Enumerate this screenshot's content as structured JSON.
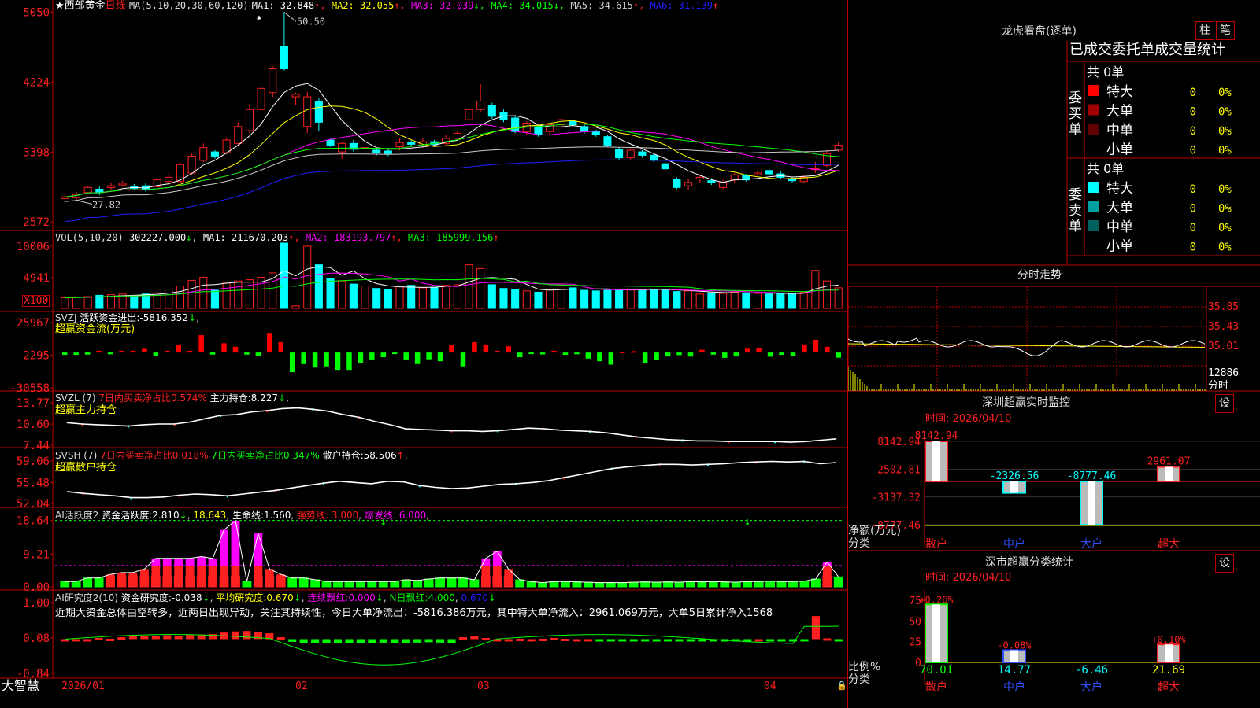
{
  "colors": {
    "up": "#ff2020",
    "down": "#00ffff",
    "frame": "#c00000",
    "buy": "#ff0000",
    "sell": "#00ffff"
  },
  "main": {
    "star": "★",
    "stock": "西部黄金",
    "period": "日线",
    "ma_prefix": "MA(5,10,20,30,60,120)",
    "ma": [
      {
        "label": "MA1: 32.848",
        "arrow": "↑",
        "color": "#ffffff"
      },
      {
        "label": "MA2: 32.055",
        "arrow": "↑",
        "color": "#ffff00"
      },
      {
        "label": "MA3: 32.039",
        "arrow": "↓",
        "color": "#ff00ff"
      },
      {
        "label": "MA4: 34.015",
        "arrow": "↓",
        "color": "#00ff00"
      },
      {
        "label": "MA5: 34.615",
        "arrow": "↑",
        "color": "#cccccc"
      },
      {
        "label": "MA6: 31.139",
        "arrow": "↑",
        "color": "#2020ff"
      }
    ],
    "yticks": [
      "5050",
      "4224",
      "3398",
      "2572"
    ],
    "high_label": "50.50",
    "low_label": "27.82"
  },
  "chart_data": [
    {
      "type": "candlestick",
      "name": "main",
      "ylim": [
        2500,
        5100
      ],
      "candles": [
        [
          2850,
          2870,
          2800,
          2920
        ],
        [
          2860,
          2900,
          2830,
          2930
        ],
        [
          2920,
          2980,
          2900,
          3000
        ],
        [
          2960,
          2920,
          2890,
          2990
        ],
        [
          2980,
          3000,
          2950,
          3040
        ],
        [
          3010,
          3030,
          2990,
          3060
        ],
        [
          2990,
          2970,
          2950,
          3020
        ],
        [
          3000,
          2950,
          2930,
          3030
        ],
        [
          2990,
          3070,
          2970,
          3090
        ],
        [
          3050,
          3100,
          3020,
          3150
        ],
        [
          3050,
          3250,
          3030,
          3280
        ],
        [
          3150,
          3350,
          3130,
          3380
        ],
        [
          3300,
          3450,
          3280,
          3500
        ],
        [
          3400,
          3350,
          3320,
          3420
        ],
        [
          3390,
          3540,
          3370,
          3570
        ],
        [
          3500,
          3700,
          3480,
          3750
        ],
        [
          3650,
          3900,
          3620,
          3960
        ],
        [
          3900,
          4150,
          3880,
          4200
        ],
        [
          4100,
          4380,
          4050,
          4410
        ],
        [
          4650,
          4380,
          4360,
          5050
        ],
        [
          4050,
          4080,
          3950,
          4100
        ],
        [
          3700,
          4050,
          3620,
          4110
        ],
        [
          4000,
          3750,
          3650,
          4030
        ],
        [
          3540,
          3480,
          3460,
          3560
        ],
        [
          3400,
          3500,
          3320,
          3510
        ],
        [
          3500,
          3430,
          3400,
          3540
        ],
        [
          3440,
          3450,
          3380,
          3500
        ],
        [
          3420,
          3390,
          3360,
          3450
        ],
        [
          3410,
          3380,
          3350,
          3440
        ],
        [
          3460,
          3510,
          3420,
          3560
        ],
        [
          3510,
          3490,
          3470,
          3540
        ],
        [
          3470,
          3520,
          3450,
          3560
        ],
        [
          3520,
          3490,
          3470,
          3540
        ],
        [
          3500,
          3560,
          3480,
          3600
        ],
        [
          3560,
          3620,
          3530,
          3650
        ],
        [
          3780,
          3900,
          3760,
          3920
        ],
        [
          3900,
          4000,
          3870,
          4200
        ],
        [
          3950,
          3820,
          3790,
          3980
        ],
        [
          3860,
          3780,
          3750,
          3900
        ],
        [
          3800,
          3640,
          3620,
          3820
        ],
        [
          3640,
          3740,
          3600,
          3760
        ],
        [
          3700,
          3600,
          3580,
          3720
        ],
        [
          3640,
          3720,
          3600,
          3740
        ],
        [
          3720,
          3780,
          3700,
          3800
        ],
        [
          3760,
          3720,
          3690,
          3790
        ],
        [
          3700,
          3640,
          3620,
          3720
        ],
        [
          3640,
          3600,
          3580,
          3660
        ],
        [
          3580,
          3480,
          3460,
          3600
        ],
        [
          3430,
          3330,
          3300,
          3450
        ],
        [
          3330,
          3420,
          3300,
          3440
        ],
        [
          3400,
          3360,
          3330,
          3420
        ],
        [
          3360,
          3300,
          3280,
          3380
        ],
        [
          3260,
          3200,
          3180,
          3280
        ],
        [
          3080,
          2980,
          2960,
          3100
        ],
        [
          3000,
          3040,
          2950,
          3080
        ],
        [
          3080,
          3100,
          3040,
          3120
        ],
        [
          3060,
          3040,
          3010,
          3090
        ],
        [
          2980,
          3040,
          2960,
          3070
        ],
        [
          3070,
          3130,
          3040,
          3150
        ],
        [
          3120,
          3070,
          3050,
          3140
        ],
        [
          3130,
          3150,
          3100,
          3180
        ],
        [
          3180,
          3140,
          3120,
          3200
        ],
        [
          3140,
          3100,
          3080,
          3170
        ],
        [
          3080,
          3060,
          3040,
          3100
        ],
        [
          3050,
          3100,
          3040,
          3130
        ],
        [
          3200,
          3200,
          3150,
          3280
        ],
        [
          3240,
          3380,
          3220,
          3420
        ],
        [
          3420,
          3480,
          3400,
          3520
        ]
      ]
    },
    {
      "type": "bar",
      "name": "volume",
      "title": "VOL(5,10,20)",
      "value_label": "302227.000",
      "value_arrow": "↓",
      "ma": [
        {
          "label": "MA1: 211670.203",
          "arrow": "↑",
          "color": "#ffffff"
        },
        {
          "label": "MA2: 183193.797",
          "arrow": "↑",
          "color": "#ff00ff"
        },
        {
          "label": "MA3: 185999.156",
          "arrow": "↑",
          "color": "#00ff00"
        }
      ],
      "yticks": [
        "10006",
        "4941"
      ],
      "unit_label": "X100",
      "ylim": [
        0,
        11000
      ],
      "values": [
        1700,
        1800,
        1900,
        2100,
        2200,
        2300,
        2000,
        2300,
        2500,
        3100,
        3600,
        4500,
        5000,
        2900,
        4200,
        4400,
        4600,
        5000,
        5700,
        10500,
        400,
        10000,
        7000,
        4800,
        4400,
        3900,
        3600,
        3200,
        3000,
        3600,
        3700,
        3300,
        3400,
        3700,
        3800,
        7000,
        6400,
        3800,
        3200,
        3000,
        2800,
        2600,
        3000,
        3700,
        3300,
        2900,
        2800,
        2900,
        3100,
        3100,
        3000,
        3100,
        2900,
        2700,
        2800,
        2300,
        2500,
        2400,
        2600,
        2500,
        2400,
        2300,
        2400,
        2300,
        2600,
        6100,
        4400,
        3300
      ]
    },
    {
      "type": "bar",
      "name": "svzj",
      "title": "SVZJ",
      "label": "活跃资金进出:",
      "value": "-5816.352",
      "value_arrow": "↓",
      "subtitle": "超赢资金流(万元)",
      "yticks": [
        "25967",
        "-2295",
        "-30558"
      ],
      "ylim": [
        -30558,
        25967
      ],
      "values": [
        -2000,
        -2000,
        -1800,
        1500,
        -1500,
        1500,
        1500,
        3200,
        -3200,
        1500,
        7000,
        1500,
        15000,
        -1800,
        8000,
        5000,
        -1800,
        -3200,
        17000,
        9000,
        -17000,
        -10000,
        -13000,
        -12000,
        -15000,
        -15000,
        -9000,
        -6000,
        -4000,
        -1200,
        -6000,
        -10000,
        -5800,
        -7500,
        6500,
        -12000,
        9000,
        7000,
        1500,
        5400,
        -4000,
        -1200,
        -1600,
        1500,
        -2000,
        -1500,
        -5200,
        -7500,
        -10500,
        800,
        1200,
        -9000,
        -6500,
        -3400,
        -2200,
        -3500,
        2400,
        -1800,
        -4600,
        -3400,
        3300,
        3500,
        -3600,
        -2000,
        -2800,
        7000,
        11000,
        5000,
        -4500
      ]
    },
    {
      "type": "line",
      "name": "svzl",
      "title": "SVZL (7)",
      "text1": "7日内买卖净占比0.574%",
      "label": "主力持仓:",
      "value": "8.227",
      "value_arrow": "↓",
      "subtitle": "超赢主力持仓",
      "yticks": [
        "13.77",
        "10.60",
        "7.44"
      ],
      "ylim": [
        7.44,
        13.77
      ],
      "values": [
        10.8,
        10.6,
        10.5,
        10.4,
        10.3,
        10.5,
        10.6,
        10.6,
        10.9,
        11.4,
        11.9,
        12.0,
        12.4,
        12.6,
        12.9,
        13.0,
        12.8,
        12.5,
        12.0,
        11.6,
        11.0,
        10.5,
        9.9,
        9.8,
        9.7,
        9.6,
        9.6,
        9.5,
        9.6,
        9.8,
        10.0,
        9.9,
        9.7,
        9.6,
        9.5,
        9.3,
        9.0,
        8.7,
        8.5,
        8.3,
        8.2,
        8.1,
        8.1,
        8.0,
        8.0,
        8.0,
        8.0,
        7.9,
        8.0,
        8.2,
        8.4
      ]
    },
    {
      "type": "line",
      "name": "svsh",
      "title": "SVSH (7)",
      "text1": "7日内买卖净占比0.018%",
      "text2": "7日内买卖净占比0.347%",
      "label": "散户持仓:",
      "value": "58.506",
      "value_arrow": "↑",
      "subtitle": "超赢散户持仓",
      "yticks": [
        "59.06",
        "55.48",
        "52.04"
      ],
      "ylim": [
        52.04,
        59.06
      ],
      "values": [
        54.0,
        53.7,
        53.5,
        53.3,
        53.0,
        53.0,
        53.1,
        53.4,
        53.6,
        53.5,
        53.3,
        53.6,
        53.9,
        54.2,
        54.6,
        55.0,
        55.4,
        55.7,
        55.5,
        55.3,
        55.7,
        55.6,
        55.0,
        54.7,
        54.5,
        54.6,
        54.9,
        55.2,
        55.3,
        55.5,
        55.8,
        56.3,
        56.8,
        57.3,
        57.8,
        58.1,
        58.3,
        58.5,
        58.5,
        58.4,
        58.5,
        58.6,
        58.8,
        58.9,
        59.0,
        58.9,
        59.0,
        58.6,
        58.8
      ]
    },
    {
      "type": "bar",
      "name": "ai_active",
      "title": "AI活跃度2",
      "label": "资金活跃度:",
      "value": "2.810",
      "value_arrow": "↓",
      "value2": "18.643",
      "label3": "生命线:",
      "value3": "1.560",
      "strong_line": "强势线: 3.000",
      "burst_line": "爆发线: 6.000",
      "yticks": [
        "18.64",
        "9.21",
        "0.00"
      ],
      "ylim": [
        0,
        19
      ],
      "values": [
        1.5,
        1.5,
        2.5,
        2.5,
        3.5,
        4.0,
        4.0,
        5.0,
        8.0,
        8.0,
        8.0,
        8.0,
        8.5,
        8.0,
        16.0,
        18.6,
        1.5,
        15.0,
        5.0,
        3.5,
        2.5,
        2.5,
        2.0,
        1.5,
        1.5,
        1.5,
        1.5,
        1.5,
        1.5,
        1.5,
        2.0,
        1.8,
        2.2,
        2.5,
        2.5,
        2.5,
        2.0,
        8.0,
        10.0,
        5.0,
        2.0,
        1.5,
        1.2,
        1.5,
        1.5,
        1.4,
        1.3,
        1.2,
        1.2,
        1.2,
        1.3,
        1.4,
        1.3,
        1.4,
        1.3,
        1.5,
        1.4,
        1.5,
        1.4,
        1.3,
        1.5,
        1.5,
        1.6,
        1.5,
        1.5,
        1.6,
        2.2,
        7.0,
        2.8
      ]
    },
    {
      "type": "bar",
      "name": "ai_research",
      "title": "AI研究度2(10)",
      "label": "资金研究度:",
      "value": "-0.038",
      "value_arrow": "↓",
      "label2": "平均研究度:",
      "value2": "0.670",
      "value2_arrow": "↓",
      "label3": "连续飘红:",
      "value3": "0.000",
      "value3_arrow": "↓",
      "label4": "N日飘红:",
      "value4": "4.000",
      "value5": "0.670",
      "value5_arrow": "↓",
      "yticks": [
        "1.00",
        "0.08",
        "-0.84"
      ],
      "ylim": [
        -0.84,
        1.0
      ],
      "values": [
        0.05,
        0.05,
        0.05,
        0.08,
        0.06,
        0.1,
        0.12,
        0.14,
        0.14,
        0.15,
        0.14,
        0.16,
        0.17,
        0.18,
        0.22,
        0.25,
        0.26,
        0.24,
        0.2,
        0.1,
        -0.02,
        -0.05,
        -0.05,
        -0.05,
        -0.06,
        -0.05,
        -0.06,
        -0.05,
        -0.04,
        -0.05,
        -0.05,
        -0.04,
        -0.03,
        -0.04,
        -0.05,
        0.1,
        0.12,
        0.08,
        0.05,
        0.05,
        0.06,
        0.05,
        0.06,
        0.08,
        0.06,
        0.05,
        0.05,
        0.04,
        0.03,
        0.03,
        0.03,
        0.03,
        0.03,
        0.02,
        0.02,
        0.02,
        0.03,
        0.02,
        0.02,
        0.03,
        0.04,
        0.05,
        0.04,
        0.03,
        0.03,
        0.02,
        0.65,
        0.07,
        0.01
      ]
    },
    {
      "type": "line",
      "name": "intraday",
      "yticks": [
        "35.85",
        "35.43",
        "35.01"
      ],
      "vol_label": "12886",
      "xlabel": "分时"
    },
    {
      "type": "bar",
      "name": "sz_monitor",
      "categories": [
        "散户",
        "中户",
        "大户",
        "超大"
      ],
      "values": [
        8142.94,
        -2326.56,
        -8777.46,
        2961.07
      ],
      "value_labels": [
        "8142.94",
        "-2326.56",
        "-8777.46",
        "2961.07"
      ],
      "yticks": [
        "8142.94",
        "2502.81",
        "-3137.32",
        "-8777.46"
      ],
      "ylim": [
        -8777.46,
        8142.94
      ]
    },
    {
      "type": "bar",
      "name": "sz_classify",
      "categories": [
        "散户",
        "中户",
        "大户",
        "超大"
      ],
      "values": [
        70.01,
        14.77,
        -6.46,
        21.69
      ],
      "top_labels": [
        "+0.26%",
        "-0.08%",
        "",
        "+0.10%"
      ],
      "yticks": [
        "75",
        "50",
        "25",
        "0"
      ],
      "ylim": [
        0,
        75
      ]
    }
  ],
  "xaxis": {
    "labels": [
      "2026/01",
      "02",
      "03",
      "04"
    ],
    "brand": "大智慧"
  },
  "right": {
    "dragon": {
      "title": "龙虎看盘(逐单)",
      "btn1": "柱",
      "btn2": "笔",
      "header": "已成交委托单成交量统计"
    },
    "buy": {
      "side_label": "委买单",
      "count": "共 0单",
      "rows": [
        {
          "name": "特大",
          "count": "0",
          "pct": "0%",
          "color": "#ff0000"
        },
        {
          "name": "大单",
          "count": "0",
          "pct": "0%",
          "color": "#a00000"
        },
        {
          "name": "中单",
          "count": "0",
          "pct": "0%",
          "color": "#600000"
        },
        {
          "name": "小单",
          "count": "0",
          "pct": "0%",
          "color": "#000000"
        }
      ]
    },
    "sell": {
      "side_label": "委卖单",
      "count": "共 0单",
      "rows": [
        {
          "name": "特大",
          "count": "0",
          "pct": "0%",
          "color": "#00ffff"
        },
        {
          "name": "大单",
          "count": "0",
          "pct": "0%",
          "color": "#00a0a0"
        },
        {
          "name": "中单",
          "count": "0",
          "pct": "0%",
          "color": "#006060"
        },
        {
          "name": "小单",
          "count": "0",
          "pct": "0%",
          "color": "#000000"
        }
      ]
    },
    "intraday_title": "分时走势",
    "monitor": {
      "title": "深圳超赢实时监控",
      "btn": "设",
      "time": "时间: 2026/04/10",
      "ylabel": "净额(万元)",
      "xlabel": "分类"
    },
    "classify": {
      "title": "深市超赢分类统计",
      "btn": "设",
      "time": "时间: 2026/04/10",
      "ylabel": "比例%",
      "xlabel": "分类"
    }
  },
  "analysis_text": "近期大资金总体由空转多，近两日出现异动，关注其持续性，今日大单净流出：-5816.386万元，其中特大单净流入：2961.069万元，大单5日累计净入1568"
}
